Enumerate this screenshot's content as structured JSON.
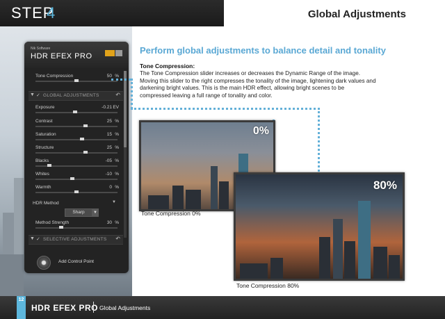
{
  "header": {
    "step_word": "STEP",
    "step_number": "4",
    "title": "Global Adjustments"
  },
  "panel": {
    "brand_small": "Nik Software",
    "brand_big": "HDR EFEX PRO",
    "tone_compression": {
      "label": "Tone Compression",
      "value": "50",
      "unit": "%",
      "level": 50
    },
    "global_section": "GLOBAL ADJUSTMENTS",
    "sliders": [
      {
        "label": "Exposure",
        "value": "-0.21",
        "unit": "EV",
        "level": 48
      },
      {
        "label": "Contrast",
        "value": "25",
        "unit": "%",
        "level": 62
      },
      {
        "label": "Saturation",
        "value": "15",
        "unit": "%",
        "level": 57
      },
      {
        "label": "Structure",
        "value": "25",
        "unit": "%",
        "level": 62
      },
      {
        "label": "Blacks",
        "value": "-05",
        "unit": "%",
        "level": 15
      },
      {
        "label": "Whites",
        "value": "-10",
        "unit": "%",
        "level": 45
      },
      {
        "label": "Warmth",
        "value": "0",
        "unit": "%",
        "level": 50
      }
    ],
    "hdr_method_label": "HDR Method",
    "hdr_method_value": "Sharp",
    "method_strength": {
      "label": "Method Strength",
      "value": "30",
      "unit": "%",
      "level": 30
    },
    "selective_section": "SELECTIVE ADJUSTMENTS",
    "add_control_point": "Add Control Point"
  },
  "content": {
    "heading": "Perform global adjustments to balance detail and tonality",
    "subheading": "Tone Compression:",
    "body": "The Tone Compression slider increases or decreases the Dynamic Range of the image. Moving this slider to the right compresses the tonality of the image, lightening dark values and darkening bright values. This is the main HDR effect, allowing bright scenes to be compressed leaving a full range of tonality and color.",
    "image1_label": "0%",
    "image1_caption": "Tone Compression 0%",
    "image2_label": "80%",
    "image2_caption": "Tone Compression 80%"
  },
  "footer": {
    "page_number": "12",
    "product": "HDR EFEX PRO",
    "section": "Global Adjustments"
  },
  "colors": {
    "accent": "#5db7dd",
    "heading": "#5aa8d4",
    "panel_bg": "#232323"
  }
}
